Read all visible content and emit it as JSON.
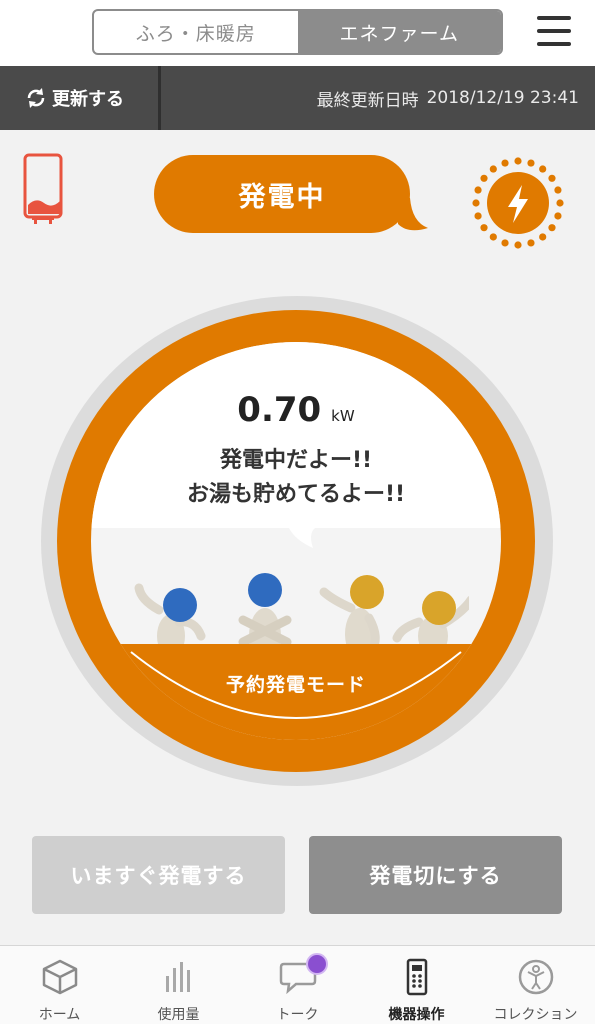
{
  "header": {
    "tabs": [
      {
        "label": "ふろ・床暖房",
        "active": false
      },
      {
        "label": "エネファーム",
        "active": true
      }
    ],
    "menu_icon": "hamburger-menu-icon"
  },
  "statusbar": {
    "refresh_label": "更新する",
    "last_update_label": "最終更新日時",
    "last_update_value": "2018/12/19 23:41"
  },
  "status": {
    "state_label": "発電中",
    "device_icon": "water-heater-unit-icon",
    "power_icon": "sun-lightning-icon"
  },
  "gauge": {
    "power_value": "0.70",
    "power_unit": "kW",
    "message_line1": "発電中だよー!!",
    "message_line2": "お湯も貯めてるよー!!",
    "mode_label": "予約発電モード"
  },
  "actions": {
    "generate_now_label": "いますぐ発電する",
    "generate_now_enabled": false,
    "generation_off_label": "発電切にする"
  },
  "tabbar": {
    "items": [
      {
        "label": "ホーム",
        "icon": "cube-home-icon"
      },
      {
        "label": "使用量",
        "icon": "bar-chart-icon"
      },
      {
        "label": "トーク",
        "icon": "chat-bubble-icon"
      },
      {
        "label": "機器操作",
        "icon": "remote-control-icon",
        "active": true
      },
      {
        "label": "コレクション",
        "icon": "collection-trophy-icon"
      }
    ]
  },
  "colors": {
    "accent": "#e07a00",
    "dark_bar": "#4a4a4a",
    "disabled_button": "#cfcfcf",
    "secondary_button": "#8e8e8e",
    "device_icon": "#e8543f",
    "badge": "#8a4fd0"
  }
}
